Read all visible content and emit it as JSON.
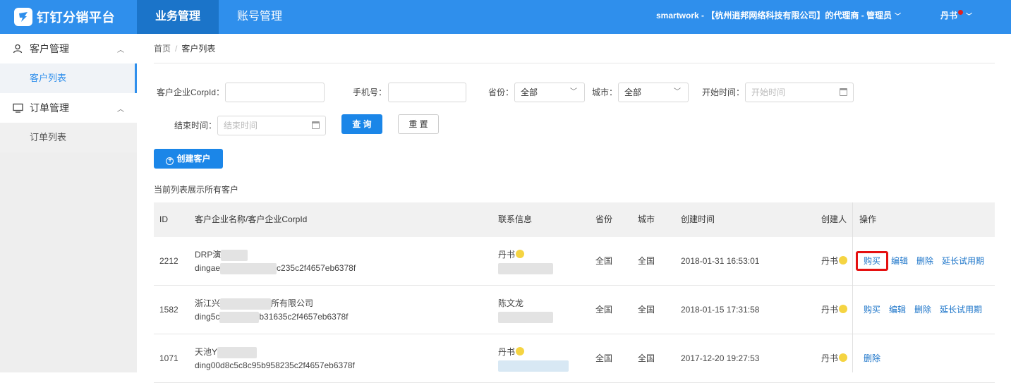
{
  "brand": {
    "title": "钉钉分销平台",
    "icon": "dingtalk-logo-icon"
  },
  "topnav": [
    {
      "label": "业务管理",
      "active": true
    },
    {
      "label": "账号管理",
      "active": false
    }
  ],
  "header": {
    "org": "smartwork - 【杭州逍邦网络科技有限公司】的代理商 - 管理员",
    "user": "丹书"
  },
  "sidebar": {
    "groups": [
      {
        "label": "客户管理",
        "icon": "user-icon",
        "items": [
          {
            "label": "客户列表",
            "active": true
          }
        ]
      },
      {
        "label": "订单管理",
        "icon": "monitor-icon",
        "items": [
          {
            "label": "订单列表",
            "active": false
          }
        ]
      }
    ]
  },
  "breadcrumb": {
    "home": "首页",
    "sep": "/",
    "current": "客户列表"
  },
  "filters": {
    "corpid_label": "客户企业CorpId：",
    "phone_label": "手机号：",
    "province_label": "省份：",
    "province_value": "全部",
    "city_label": "城市：",
    "city_value": "全部",
    "start_label": "开始时间：",
    "start_placeholder": "开始时间",
    "end_label": "结束时间：",
    "end_placeholder": "结束时间",
    "query_button": "查 询",
    "reset_button": "重 置"
  },
  "create_button": "创建客户",
  "list_hint": "当前列表展示所有客户",
  "table": {
    "headers": [
      "ID",
      "客户企业名称/客户企业CorpId",
      "联系信息",
      "省份",
      "城市",
      "创建时间",
      "创建人",
      "操作"
    ],
    "rows": [
      {
        "id": "2212",
        "name": "DRP演",
        "corpid": "dingae",
        "corpid_tail": "c235c2f4657eb6378f",
        "contact": "丹书",
        "province": "全国",
        "city": "全国",
        "created": "2018-01-31 16:53:01",
        "creator": "丹书",
        "ops": [
          "购买",
          "编辑",
          "删除",
          "延长试用期"
        ]
      },
      {
        "id": "1582",
        "name": "浙江兴",
        "name_tail": "所有限公司",
        "corpid": "ding5c",
        "corpid_tail": "b31635c2f4657eb6378f",
        "contact": "陈文龙",
        "province": "全国",
        "city": "全国",
        "created": "2018-01-15 17:31:58",
        "creator": "丹书",
        "ops": [
          "购买",
          "编辑",
          "删除",
          "延长试用期"
        ]
      },
      {
        "id": "1071",
        "name": "天池Y",
        "corpid": "ding00d8c5c8c95b958235c2f4657eb6378f",
        "contact": "丹书",
        "province": "全国",
        "city": "全国",
        "created": "2017-12-20 19:27:53",
        "creator": "丹书",
        "ops": [
          "删除"
        ]
      }
    ]
  }
}
